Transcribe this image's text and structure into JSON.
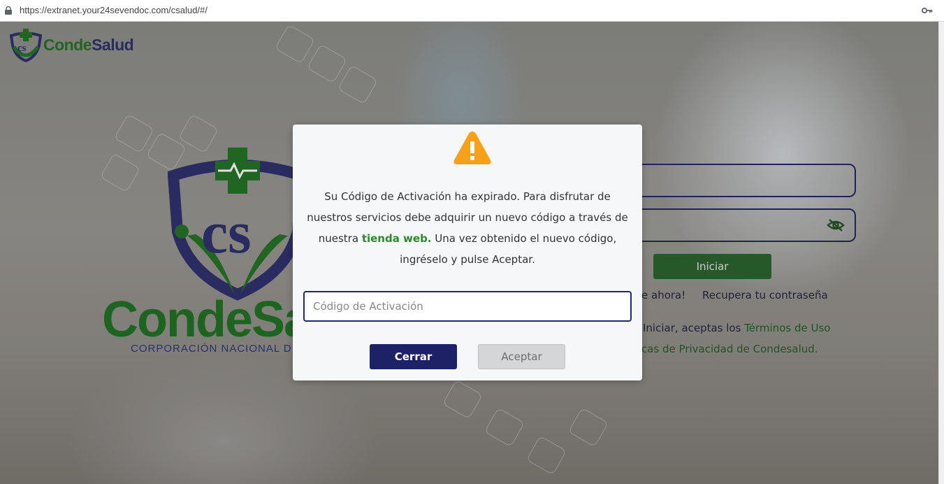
{
  "browser": {
    "url": "https://extranet.your24sevendoc.com/csalud/#/"
  },
  "header_logo": {
    "brand_part1": "Conde",
    "brand_part2": "Salud"
  },
  "big_logo": {
    "brand": "CondeSa",
    "tagline": "CORPORACIÓN NACIONAL D"
  },
  "login": {
    "submit_label": "Iniciar",
    "register_link": "e ahora!",
    "recover_link": "Recupera tu contraseña",
    "terms_prefix": "Iniciar, aceptas los ",
    "terms_link": "Términos de Uso",
    "privacy_text": "cas de Privacidad de Condesalud."
  },
  "modal": {
    "message_part1": "Su Código de Activación ha expirado. Para disfrutar de nuestros servicios debe adquirir un nuevo código a través de nuestra ",
    "message_link": "tienda web.",
    "message_part2": " Una vez obtenido el nuevo código, ingréselo y pulse Aceptar.",
    "input_placeholder": "Código de Activación",
    "input_value": "",
    "close_label": "Cerrar",
    "accept_label": "Aceptar"
  },
  "colors": {
    "brand_green": "#1f6f20",
    "brand_navy": "#2a2c6a",
    "warning_orange": "#f7a11a",
    "close_button": "#1d2166",
    "accept_button_disabled": "#d5d6d8"
  }
}
